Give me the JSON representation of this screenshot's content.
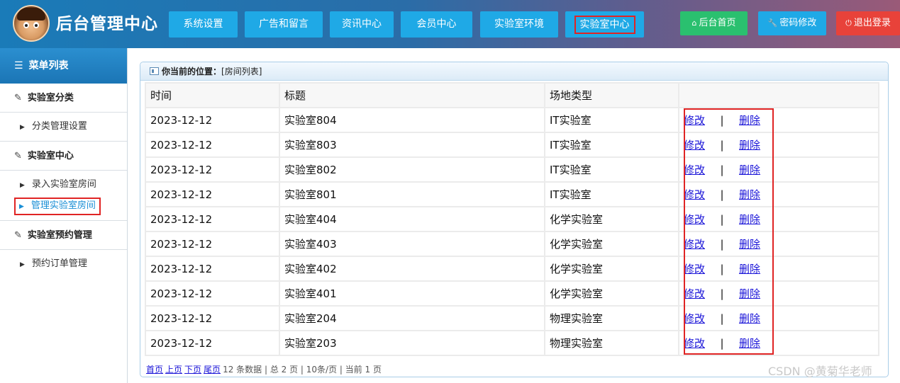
{
  "header": {
    "site_title": "后台管理中心",
    "nav": [
      {
        "label": "系统设置"
      },
      {
        "label": "广告和留言"
      },
      {
        "label": "资讯中心"
      },
      {
        "label": "会员中心"
      },
      {
        "label": "实验室环境"
      },
      {
        "label": "实验室中心"
      }
    ],
    "right_buttons": [
      {
        "label": "后台首页",
        "icon": "home-icon"
      },
      {
        "label": "密码修改",
        "icon": "wrench-icon"
      },
      {
        "label": "退出登录",
        "icon": "power-icon"
      }
    ]
  },
  "sidebar": {
    "menu_title": "菜单列表",
    "groups": [
      {
        "title": "实验室分类",
        "items": [
          {
            "label": "分类管理设置"
          }
        ]
      },
      {
        "title": "实验室中心",
        "items": [
          {
            "label": "录入实验室房间"
          },
          {
            "label": "管理实验室房间"
          }
        ]
      },
      {
        "title": "实验室预约管理",
        "items": [
          {
            "label": "预约订单管理"
          }
        ]
      }
    ]
  },
  "panel": {
    "location_label": "你当前的位置：",
    "location_value": "[房间列表]"
  },
  "table": {
    "columns": [
      "时间",
      "标题",
      "场地类型",
      ""
    ],
    "edit_label": "修改",
    "separator": "|",
    "delete_label": "删除",
    "rows": [
      {
        "time": "2023-12-12",
        "title": "实验室804",
        "type": "IT实验室"
      },
      {
        "time": "2023-12-12",
        "title": "实验室803",
        "type": "IT实验室"
      },
      {
        "time": "2023-12-12",
        "title": "实验室802",
        "type": "IT实验室"
      },
      {
        "time": "2023-12-12",
        "title": "实验室801",
        "type": "IT实验室"
      },
      {
        "time": "2023-12-12",
        "title": "实验室404",
        "type": "化学实验室"
      },
      {
        "time": "2023-12-12",
        "title": "实验室403",
        "type": "化学实验室"
      },
      {
        "time": "2023-12-12",
        "title": "实验室402",
        "type": "化学实验室"
      },
      {
        "time": "2023-12-12",
        "title": "实验室401",
        "type": "化学实验室"
      },
      {
        "time": "2023-12-12",
        "title": "实验室204",
        "type": "物理实验室"
      },
      {
        "time": "2023-12-12",
        "title": "实验室203",
        "type": "物理实验室"
      }
    ]
  },
  "pager": {
    "first": "首页",
    "prev": "上页",
    "next": "下页",
    "last": "尾页",
    "summary": "12 条数据 | 总 2 页 | 10条/页 | 当前 1 页"
  },
  "watermark": "CSDN @黄菊华老师",
  "colors": {
    "nav_button": "#1fa9e6",
    "home_button": "#2ac06f",
    "logout_button": "#e8423a",
    "highlight_box": "#e02424",
    "link": "#1a14d8"
  }
}
